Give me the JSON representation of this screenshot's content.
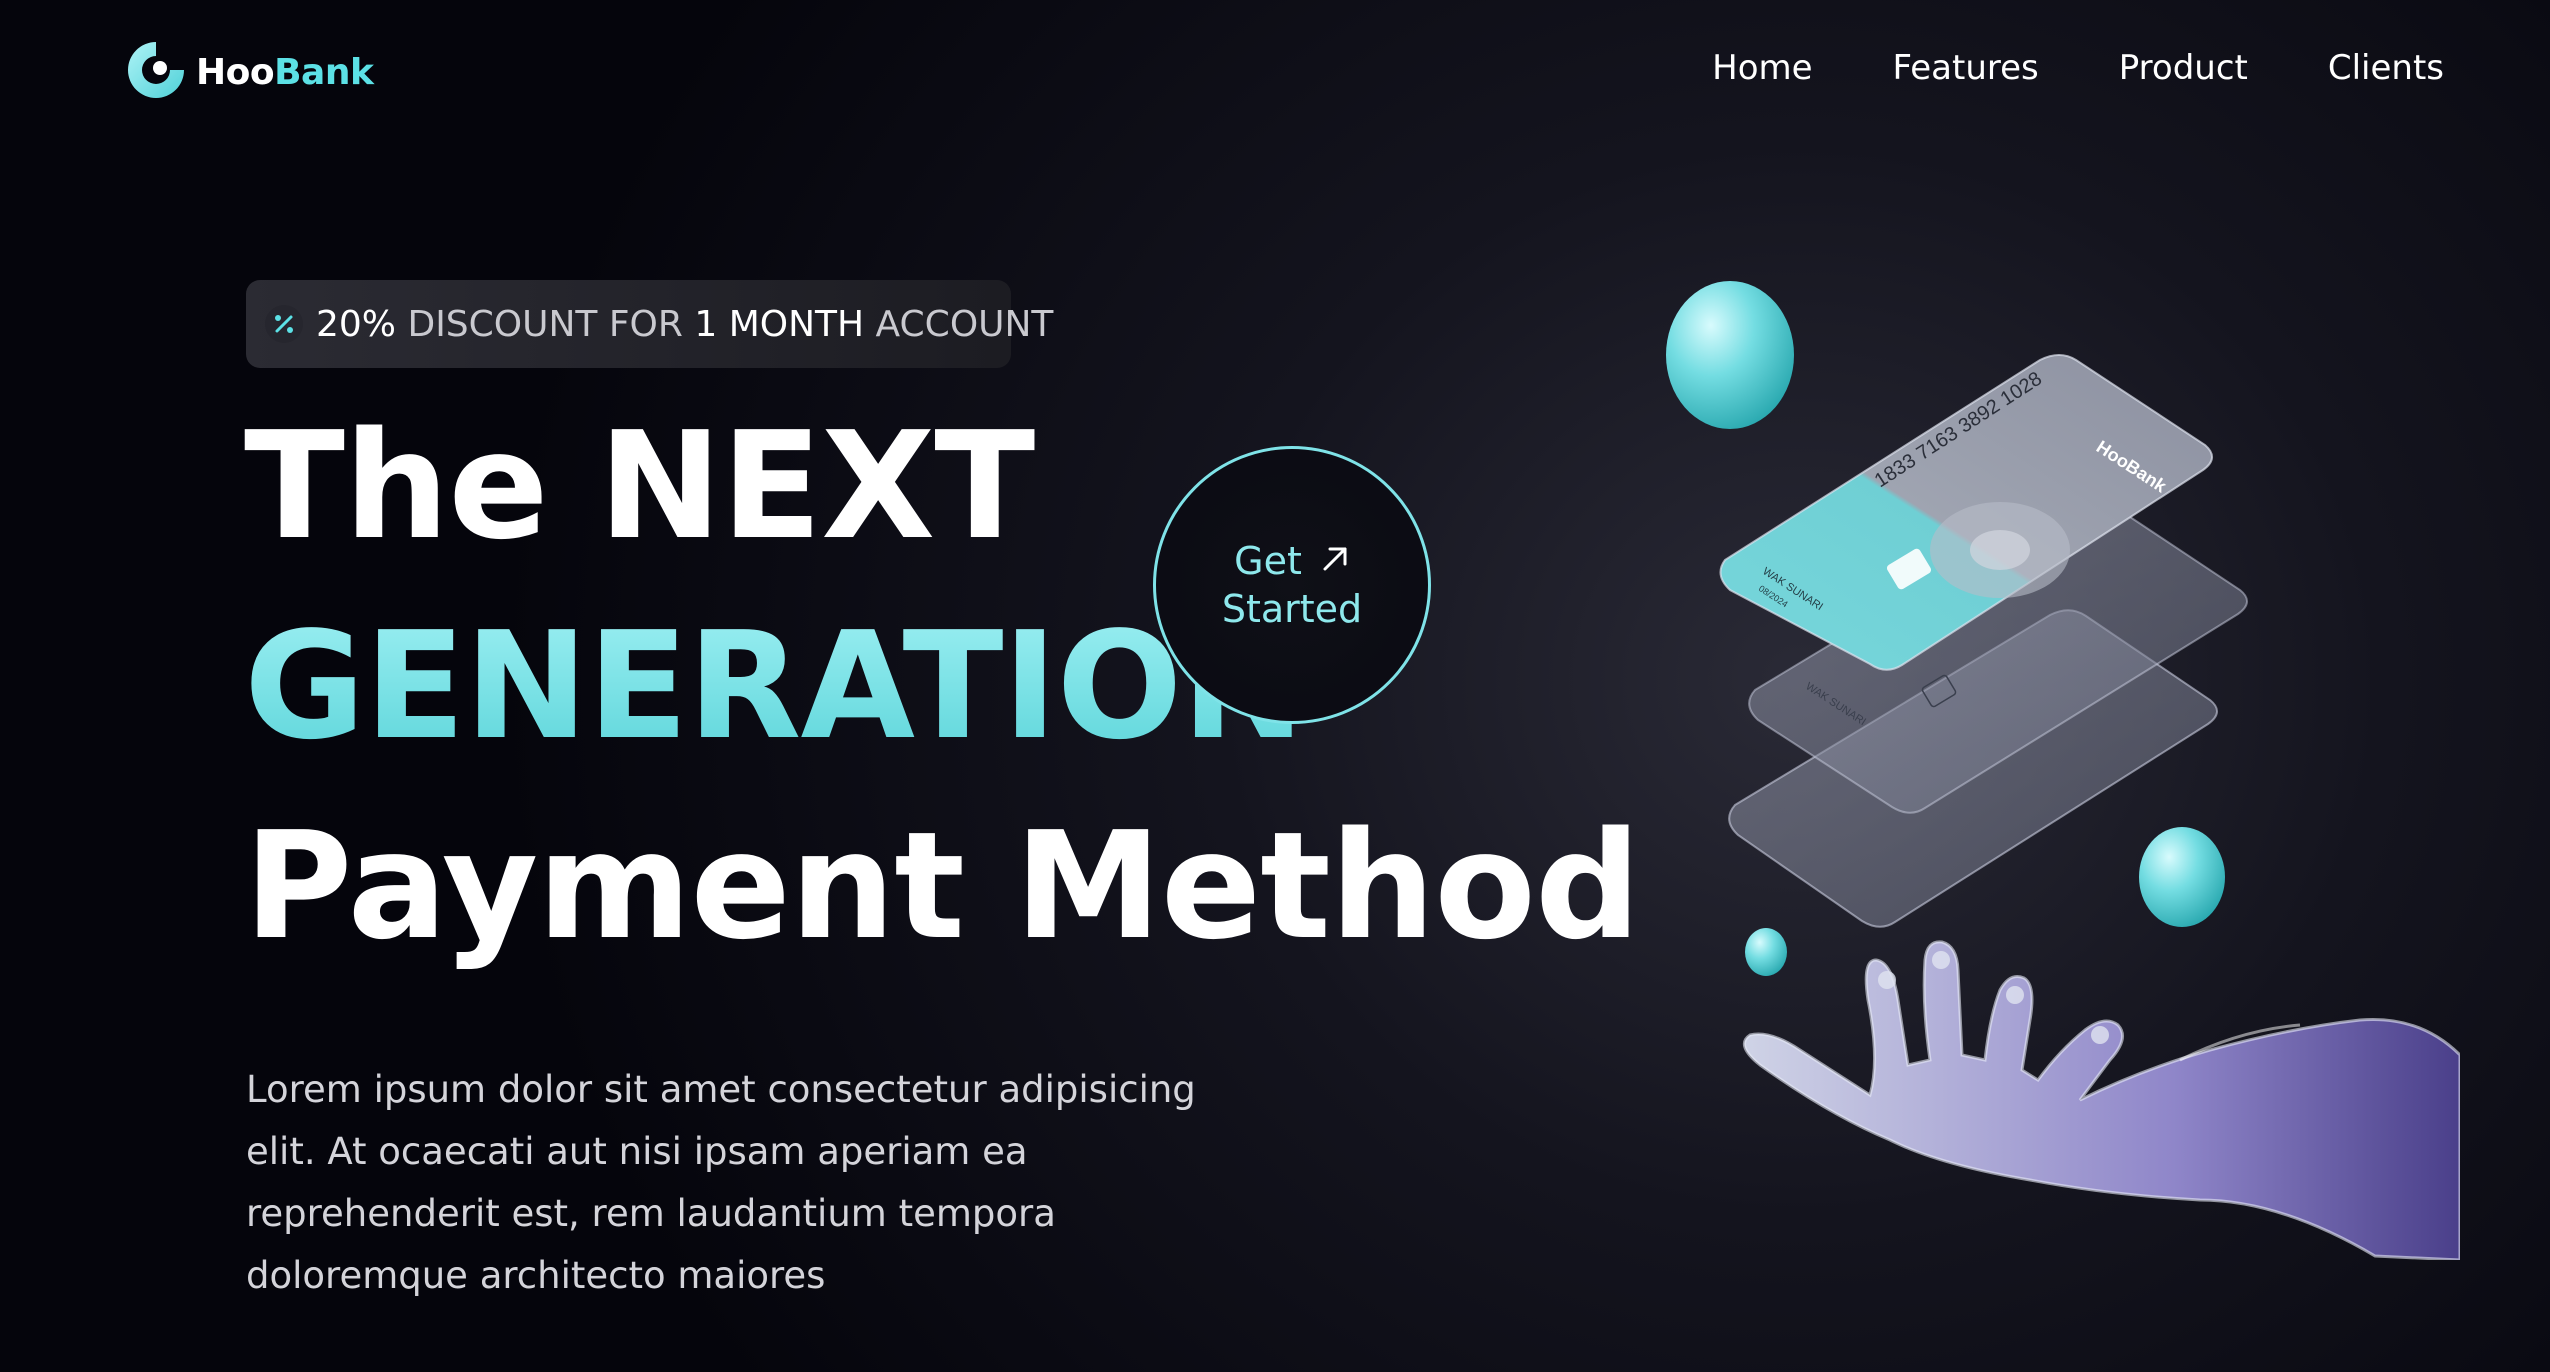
{
  "nav": {
    "logo": {
      "icon": "hoobank-logo-icon",
      "text_hoo": "Hoo",
      "text_bank": "Bank"
    },
    "links": [
      "Home",
      "Features",
      "Product",
      "Clients"
    ]
  },
  "badge": {
    "icon": "discount-percent-icon",
    "percent": "20%",
    "text1": "DISCOUNT FOR",
    "highlight": "1 MONTH",
    "text2": "ACCOUNT"
  },
  "headline": {
    "line1": "The NEXT",
    "line2": "GENERATION",
    "line3": "Payment Method"
  },
  "cta": {
    "line1": "Get",
    "line2": "Started",
    "icon": "arrow-up-right-icon"
  },
  "description": "Lorem ipsum dolor sit amet consectetur adipisicing elit. At ocaecati aut nisi ipsam aperiam ea reprehenderit est, rem laudantium tempora doloremque architecto maiores",
  "hero_image": {
    "card_number": "1833 7163 3892 1028",
    "card_brand": "HooBank",
    "card_holder": "WAK SUNARI",
    "card_expiry": "08/2024"
  },
  "colors": {
    "accent": "#5ce1e6",
    "background": "#05050c",
    "text": "#ffffff",
    "muted": "#c9c9cf"
  }
}
